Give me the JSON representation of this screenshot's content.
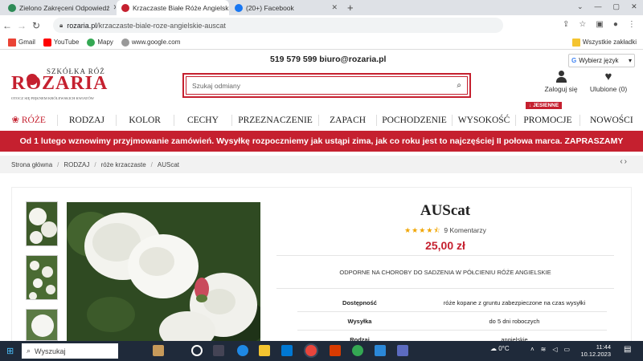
{
  "browser": {
    "tabs": [
      {
        "label": "Zielono Zakręceni Odpowiedź"
      },
      {
        "label": "Krzaczaste Białe Róże Angielski"
      },
      {
        "label": "(20+) Facebook"
      }
    ],
    "new_tab": "+",
    "url_domain": "rozaria.pl",
    "url_path": "/krzaczaste-biale-roze-angielskie-auscat",
    "bookmarks": [
      {
        "label": "Gmail"
      },
      {
        "label": "YouTube"
      },
      {
        "label": "Mapy"
      },
      {
        "label": "www.google.com"
      }
    ],
    "all_bookmarks": "Wszystkie zakładki"
  },
  "site": {
    "contact": "519 579 599 biuro@rozaria.pl",
    "language": "Wybierz język",
    "logo_top": "SZKÓŁKA RÓŻ",
    "logo_name": "ROZARIA",
    "logo_tagline": "OTOCZ SIĘ PIĘKNEM KRÓLEWSKICH KWIATÓW",
    "search_placeholder": "Szukaj odmiany",
    "login": "Zaloguj się",
    "favourites": "Ulubione (0)",
    "menu": [
      "RÓŻE",
      "RODZAJ",
      "KOLOR",
      "CECHY",
      "PRZEZNACZENIE",
      "ZAPACH",
      "POCHODZENIE",
      "WYSOKOŚĆ",
      "PROMOCJE",
      "NOWOŚCI"
    ],
    "badge": "JESIENNE",
    "banner": "Od 1 lutego wznowimy przyjmowanie zamówień. Wysyłkę rozpoczniemy jak ustąpi zima, jak co roku jest to najczęściej II połowa marca. ZAPRASZAMY",
    "breadcrumb": [
      "Strona główna",
      "RODZAJ",
      "róże krzaczaste",
      "AUScat"
    ]
  },
  "product": {
    "name": "AUScat",
    "rating": 4.5,
    "comments": "9 Komentarzy",
    "price": "25,00 zł",
    "tags": "ODPORNE NA CHOROBY DO SADZENIA W PÓŁCIENIU RÓŻE ANGIELSKIE",
    "attributes": [
      {
        "key": "Dostępność",
        "value": "róże kopane z gruntu zabezpieczone na czas wysyłki"
      },
      {
        "key": "Wysyłka",
        "value": "do 5 dni roboczych"
      },
      {
        "key": "Rodzaj",
        "value": "angielskie"
      }
    ]
  },
  "taskbar": {
    "search": "Wyszukaj",
    "weather": "0°C",
    "time": "11:44",
    "date": "10.12.2023"
  },
  "colors": {
    "brand": "#c5202f",
    "taskbar": "#1f2a3a"
  }
}
